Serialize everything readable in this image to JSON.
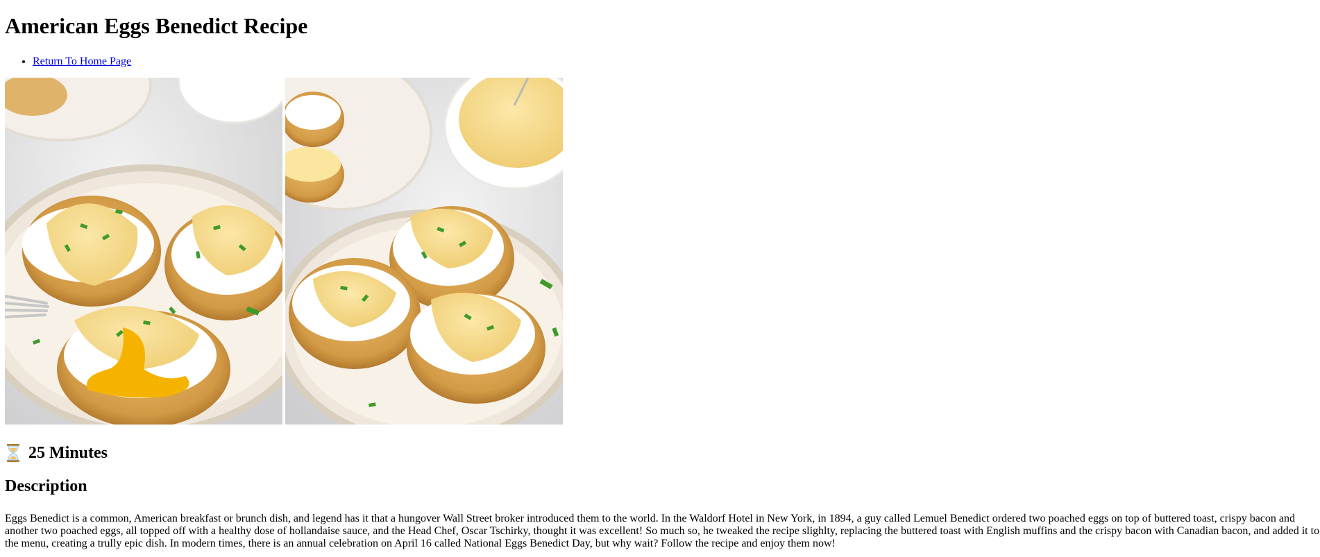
{
  "page": {
    "title": "American Eggs Benedict Recipe",
    "nav": [
      {
        "label": "Return To Home Page"
      }
    ]
  },
  "gallery": {
    "photos": [
      {
        "subject": "eggs benedict plate, overhead, with cut yolk and fork"
      },
      {
        "subject": "eggs benedict plate with hollandaise bowl"
      }
    ]
  },
  "recipe": {
    "time_icon": "hourglass-icon",
    "time": "25 Minutes",
    "description_heading": "Description",
    "description": "Eggs Benedict is a common, American breakfast or brunch dish, and legend has it that a hungover Wall Street broker introduced them to the world. In the Waldorf Hotel in New York, in 1894, a guy called Lemuel Benedict ordered two poached eggs on top of buttered toast, crispy bacon and another two poached eggs, all topped off with a healthy dose of hollandaise sauce, and the Head Chef, Oscar Tschirky, thought it was excellent! So much so, he tweaked the recipe slighlty, replacing the buttered toast with English muffins and the crispy bacon with Canadian bacon, and added it to the menu, creating a trully epic dish. In modern times, there is an annual celebration on April 16 called National Eggs Benedict Day, but why wait? Follow the recipe and enjoy them now!"
  },
  "colors": {
    "link": "#0000ee",
    "text": "#000000",
    "background": "#ffffff"
  }
}
